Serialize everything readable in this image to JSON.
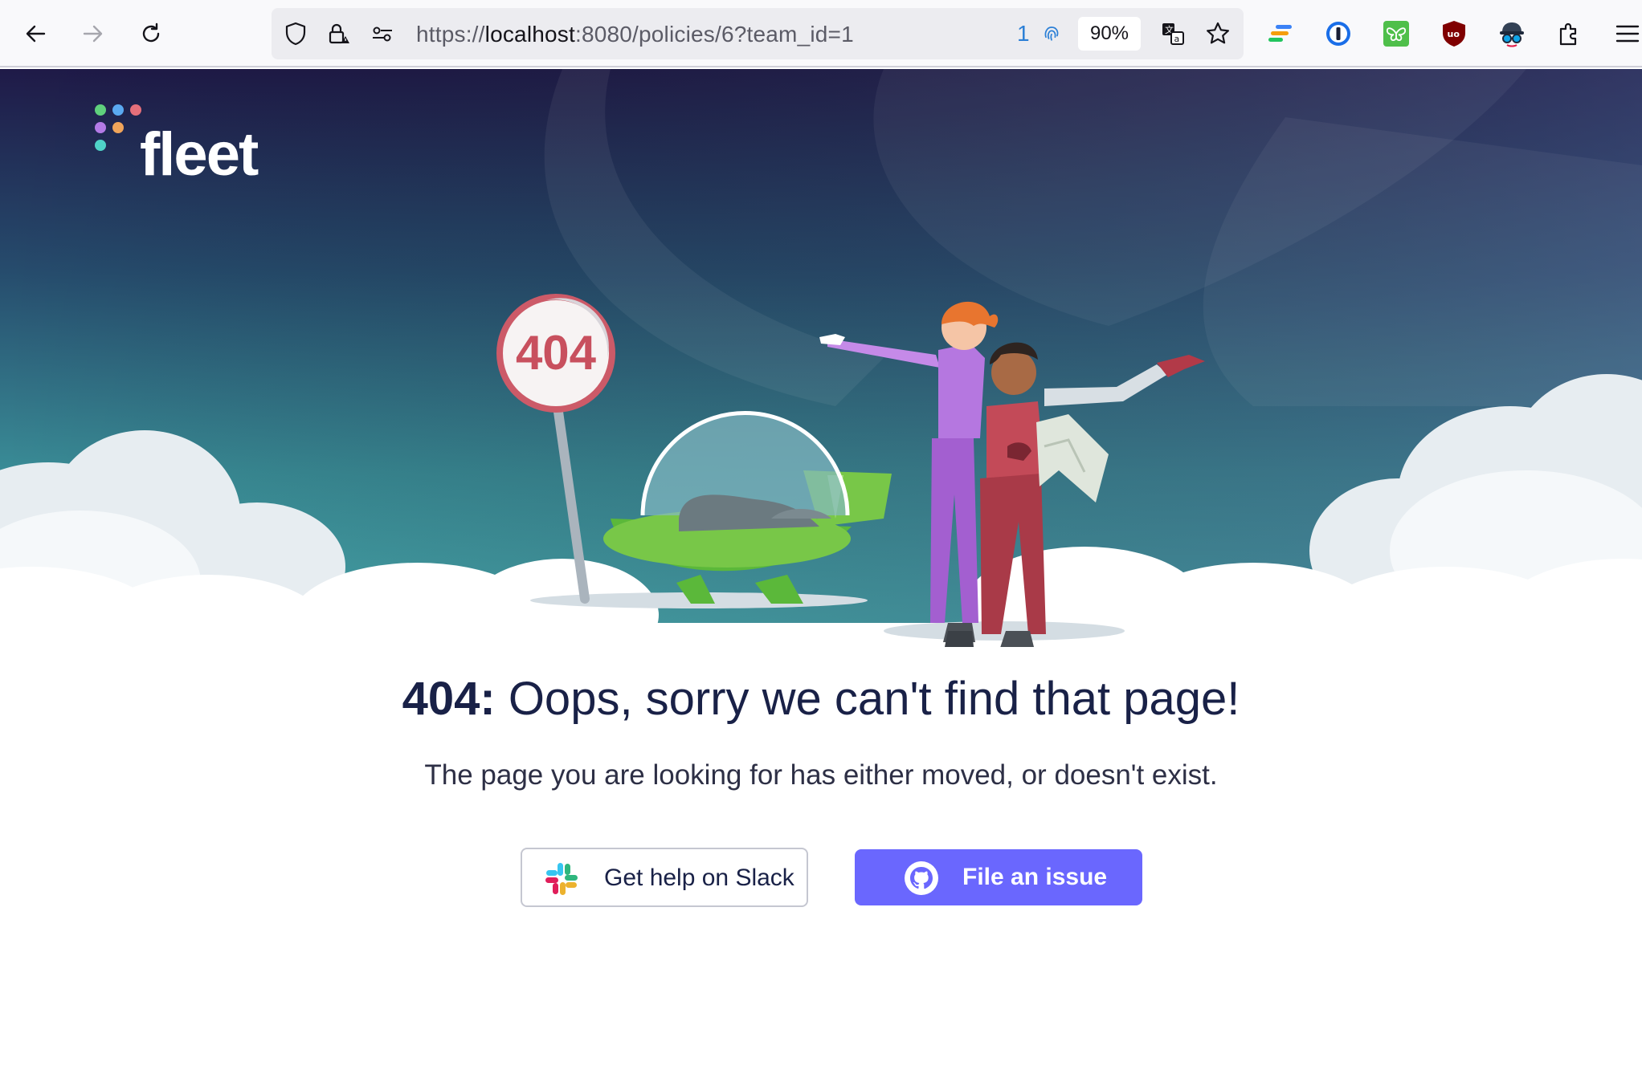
{
  "browser": {
    "url_prefix": "https://",
    "url_host": "localhost",
    "url_rest": ":8080/policies/6?team_id=1",
    "fingerprint_count": "1",
    "zoom": "90%",
    "icons": [
      "back-icon",
      "forward-icon",
      "reload-icon",
      "shield-icon",
      "lock-warning-icon",
      "permissions-icon",
      "translate-icon",
      "bookmark-star-icon",
      "extension-stack-icon",
      "onepassword-icon",
      "butterfly-extension-icon",
      "ublock-icon",
      "spy-extension-icon",
      "extensions-icon",
      "menu-icon"
    ]
  },
  "brand": {
    "name": "fleet",
    "dot_colors": [
      "#5fd07c",
      "#5aa9f0",
      "#e56f7a",
      "#b37ae6",
      "#f0a45a",
      "#4fd3c8"
    ]
  },
  "illustration": {
    "sign_text": "404"
  },
  "error": {
    "code": "404:",
    "message": " Oops, sorry we can't find that page!",
    "description": "The page you are looking for has either moved, or doesn't exist."
  },
  "actions": {
    "slack_label": "Get help on Slack",
    "issue_label": "File an issue"
  },
  "colors": {
    "primary_button": "#6a67fe",
    "headline": "#192147"
  }
}
